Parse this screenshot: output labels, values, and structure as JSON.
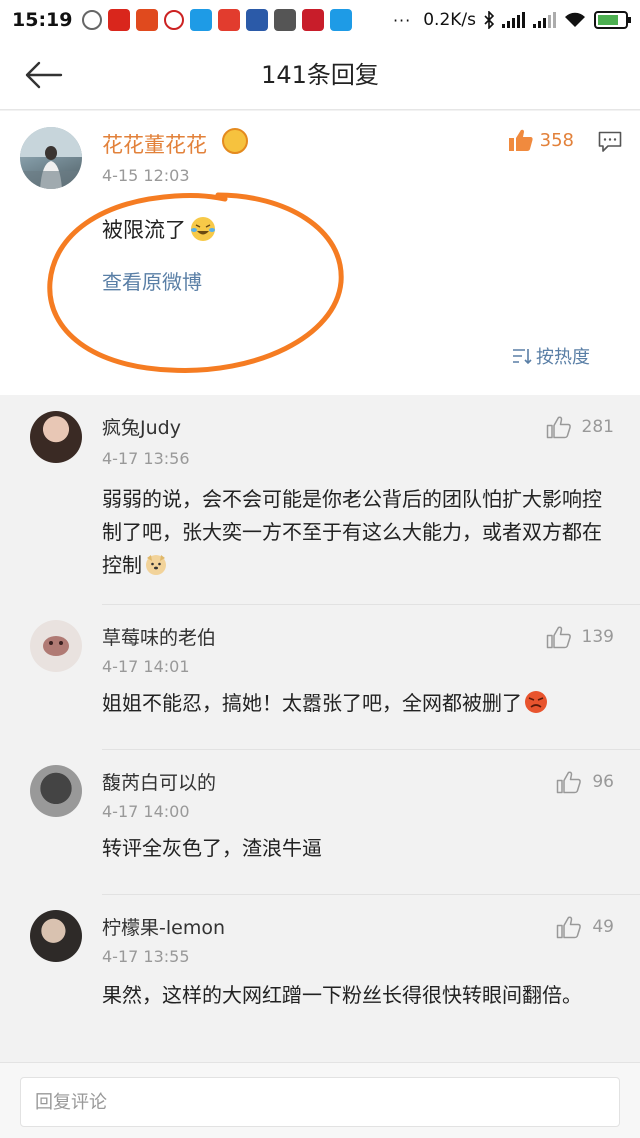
{
  "status_bar": {
    "time": "15:19",
    "network_speed": "0.2K/s",
    "icons": [
      "wechat-icon",
      "app-icon",
      "app-icon",
      "app-icon",
      "app-icon",
      "app-icon",
      "app-icon",
      "app-icon",
      "app-icon",
      "app-icon"
    ],
    "more": "···"
  },
  "header": {
    "title": "141条回复"
  },
  "main_post": {
    "user_name": "花花董花花",
    "time": "4-15 12:03",
    "likes": "358",
    "text": "被限流了",
    "view_original": "查看原微博",
    "sort_label": "按热度"
  },
  "comments": [
    {
      "name": "疯兔Judy",
      "time": "4-17 13:56",
      "likes": "281",
      "text": "弱弱的说，会不会可能是你老公背后的团队怕扩大影响控制了吧，张大奕一方不至于有这么大能力，或者双方都在控制"
    },
    {
      "name": "草莓味的老伯",
      "time": "4-17 14:01",
      "likes": "139",
      "text": "姐姐不能忍，搞她！太嚣张了吧，全网都被删了"
    },
    {
      "name": "馥芮白可以的",
      "time": "4-17 14:00",
      "likes": "96",
      "text": "转评全灰色了，渣浪牛逼"
    },
    {
      "name": "柠檬果-lemon",
      "time": "4-17 13:55",
      "likes": "49",
      "text": "果然，这样的大网红蹭一下粉丝长得很快转眼间翻倍。"
    }
  ],
  "reply_bar": {
    "placeholder": "回复评论"
  },
  "colors": {
    "accent_orange": "#e2813a",
    "link_blue": "#5a7fa6",
    "annotation": "#f57c22"
  }
}
